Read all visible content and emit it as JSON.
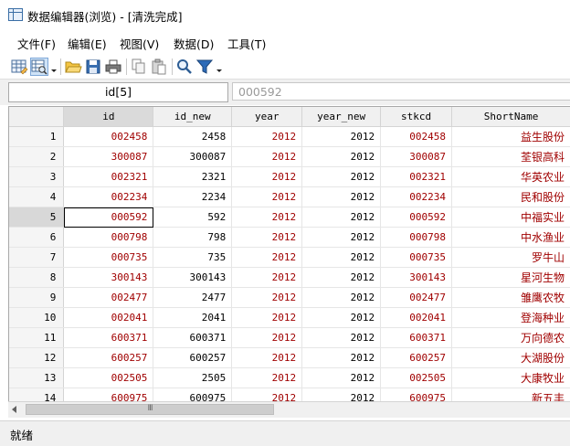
{
  "window": {
    "title": "数据编辑器(浏览) - [清洗完成]"
  },
  "menu": [
    "文件(F)",
    "编辑(E)",
    "视图(V)",
    "数据(D)",
    "工具(T)"
  ],
  "toolbar_icons": [
    "data-editor-edit-icon",
    "data-editor-browse-icon",
    "dropdown-arrow-icon",
    "open-folder-icon",
    "save-icon",
    "print-icon",
    "copy-icon",
    "paste-icon",
    "search-icon",
    "filter-icon",
    "dropdown-arrow-icon"
  ],
  "formula": {
    "variable_label": "id[5]",
    "value": "000592"
  },
  "columns": [
    "id",
    "id_new",
    "year",
    "year_new",
    "stkcd",
    "ShortName"
  ],
  "rows": [
    [
      "1",
      "002458",
      "2458",
      "2012",
      "2012",
      "002458",
      "益生股份"
    ],
    [
      "2",
      "300087",
      "300087",
      "2012",
      "2012",
      "300087",
      "荃银高科"
    ],
    [
      "3",
      "002321",
      "2321",
      "2012",
      "2012",
      "002321",
      "华英农业"
    ],
    [
      "4",
      "002234",
      "2234",
      "2012",
      "2012",
      "002234",
      "民和股份"
    ],
    [
      "5",
      "000592",
      "592",
      "2012",
      "2012",
      "000592",
      "中福实业"
    ],
    [
      "6",
      "000798",
      "798",
      "2012",
      "2012",
      "000798",
      "中水渔业"
    ],
    [
      "7",
      "000735",
      "735",
      "2012",
      "2012",
      "000735",
      "罗牛山"
    ],
    [
      "8",
      "300143",
      "300143",
      "2012",
      "2012",
      "300143",
      "星河生物"
    ],
    [
      "9",
      "002477",
      "2477",
      "2012",
      "2012",
      "002477",
      "雏鹰农牧"
    ],
    [
      "10",
      "002041",
      "2041",
      "2012",
      "2012",
      "002041",
      "登海种业"
    ],
    [
      "11",
      "600371",
      "600371",
      "2012",
      "2012",
      "600371",
      "万向德农"
    ],
    [
      "12",
      "600257",
      "600257",
      "2012",
      "2012",
      "600257",
      "大湖股份"
    ],
    [
      "13",
      "002505",
      "2505",
      "2012",
      "2012",
      "002505",
      "大康牧业"
    ],
    [
      "14",
      "600975",
      "600975",
      "2012",
      "2012",
      "600975",
      "新五丰"
    ]
  ],
  "selected_row": 5,
  "scrollbar": {
    "thumb_grip": "III"
  },
  "status": "就绪"
}
